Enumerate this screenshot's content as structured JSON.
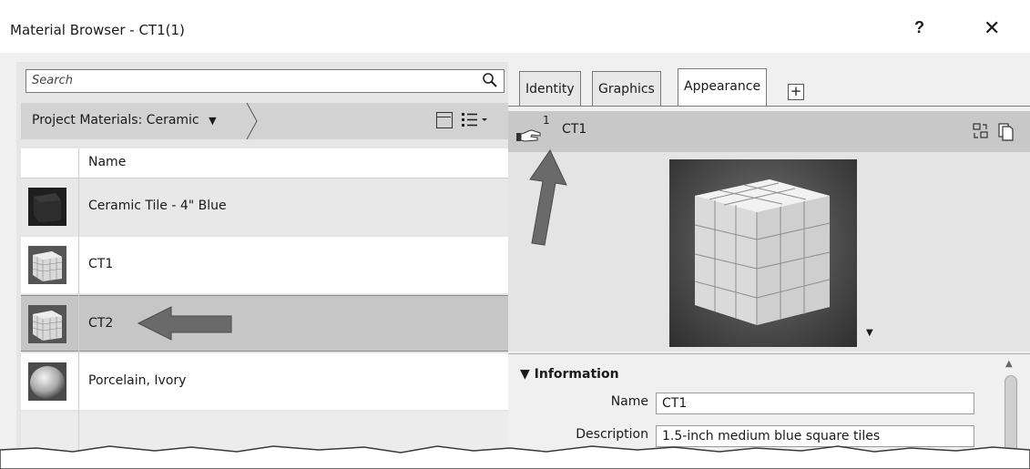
{
  "window": {
    "title": "Material Browser - CT1(1)",
    "help_label": "?",
    "close_label": "✕"
  },
  "search": {
    "placeholder": "Search",
    "value": ""
  },
  "library": {
    "breadcrumb": "Project Materials: Ceramic",
    "caret": "▼"
  },
  "list": {
    "column_name": "Name",
    "items": [
      {
        "label": "Ceramic Tile - 4\" Blue",
        "thumbnail": "dark-cube"
      },
      {
        "label": "CT1",
        "thumbnail": "tile-cube"
      },
      {
        "label": "CT2",
        "thumbnail": "tile-cube",
        "selected": true
      },
      {
        "label": "Porcelain, Ivory",
        "thumbnail": "porcelain-sphere"
      }
    ]
  },
  "tabs": [
    {
      "label": "Identity"
    },
    {
      "label": "Graphics"
    },
    {
      "label": "Appearance",
      "active": true
    }
  ],
  "add_tab_label": "+",
  "asset": {
    "count": "1",
    "name": "CT1"
  },
  "information": {
    "header": "▼ Information",
    "fields": [
      {
        "label": "Name",
        "value": "CT1"
      },
      {
        "label": "Description",
        "value": "1.5-inch medium blue square tiles"
      }
    ]
  },
  "colors": {
    "selected_row": "#c6c6c6",
    "annotation_arrow": "#6a6a6a"
  }
}
